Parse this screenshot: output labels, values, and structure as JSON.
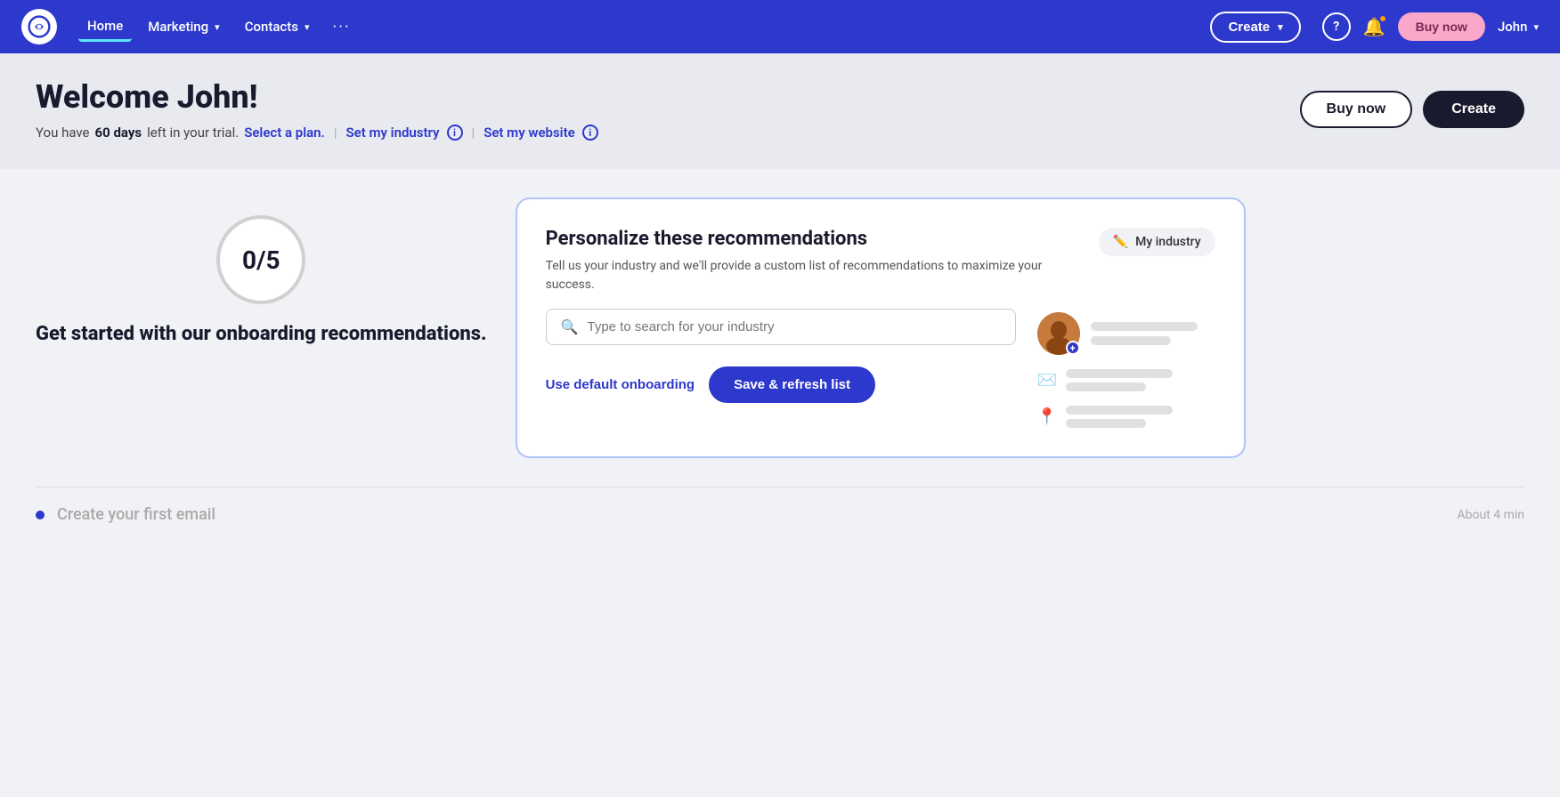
{
  "app": {
    "logo_alt": "Constant Contact"
  },
  "navbar": {
    "home": "Home",
    "marketing": "Marketing",
    "contacts": "Contacts",
    "more": "···",
    "create": "Create",
    "help_title": "Help",
    "buy_now": "Buy now",
    "user": "John"
  },
  "header": {
    "title": "Welcome John!",
    "trial_text": "You have ",
    "trial_days": "60 days",
    "trial_suffix": " left in your trial.",
    "select_plan": "Select a plan.",
    "set_industry": "Set my industry",
    "set_website": "Set my website",
    "btn_buy_now": "Buy now",
    "btn_create": "Create"
  },
  "progress": {
    "count": "0/5",
    "label": "Get started with our onboarding recommendations."
  },
  "card": {
    "title": "Personalize these recommendations",
    "subtitle": "Tell us your industry and we'll provide a custom list of recommendations to maximize your success.",
    "my_industry_label": "My industry",
    "search_placeholder": "Type to search for your industry",
    "btn_default": "Use default onboarding",
    "btn_save": "Save & refresh list"
  },
  "bottom_items": [
    {
      "title": "Create your first email",
      "time": "About 4 min"
    }
  ]
}
